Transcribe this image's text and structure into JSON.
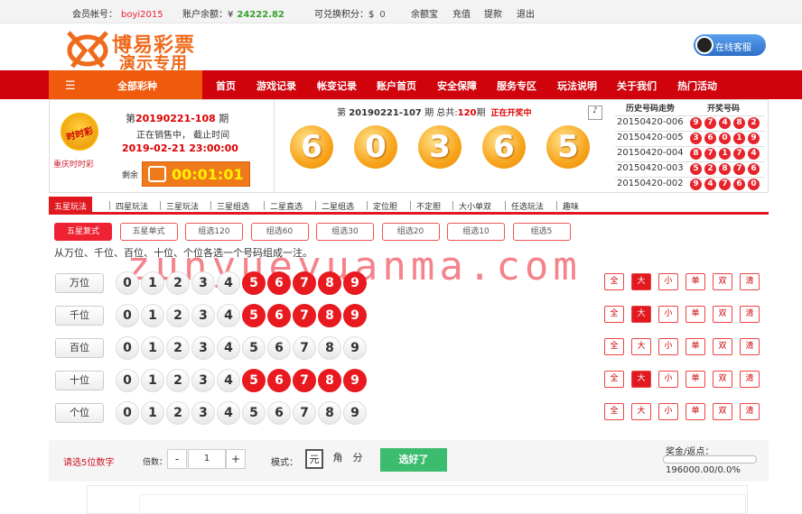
{
  "topbar": {
    "member_label": "会员帐号：",
    "member_value": "boyi2015",
    "balance_label": "账户余额：",
    "currency": "¥",
    "balance_value": "24222.82",
    "points_label": "可兑换积分：",
    "points_currency": "$",
    "points_value": "0",
    "links": [
      "余额宝",
      "充值",
      "提款",
      "退出"
    ]
  },
  "logo": {
    "line1": "博易彩票",
    "line2": "演示专用",
    "brand_color": "#ef6a1b"
  },
  "service_label": "在线客服",
  "nav": {
    "all_label": "全部彩种",
    "items": [
      "首页",
      "游戏记录",
      "帐变记录",
      "账户首页",
      "安全保障",
      "服务专区",
      "玩法说明",
      "关于我们",
      "热门活动"
    ],
    "bg_color": "#d0020b",
    "accent_color": "#ef5a0c"
  },
  "lottery": {
    "logo_text": "时时彩",
    "name": "重庆时时彩",
    "issue_prefix": "第",
    "issue": "20190221-108",
    "issue_suffix": "期",
    "status": "正在销售中，  截止时间",
    "deadline": "2019-02-21 23:00:00",
    "remaining_label": "剩余",
    "countdown": "00:01:01"
  },
  "draw": {
    "prefix": "第",
    "issue": "20190221-107",
    "mid": "期 总共:",
    "total": "120",
    "suffix": "期",
    "live": "正在开奖中",
    "numbers": [
      "6",
      "0",
      "3",
      "6",
      "5"
    ]
  },
  "history": {
    "header_trend": "历史号码走势",
    "header_numbers": "开奖号码",
    "rows": [
      {
        "issue": "20150420-006",
        "nums": [
          "9",
          "7",
          "4",
          "8",
          "2"
        ]
      },
      {
        "issue": "20150420-005",
        "nums": [
          "3",
          "6",
          "0",
          "1",
          "9"
        ]
      },
      {
        "issue": "20150420-004",
        "nums": [
          "8",
          "7",
          "1",
          "7",
          "4"
        ]
      },
      {
        "issue": "20150420-003",
        "nums": [
          "5",
          "2",
          "8",
          "7",
          "6"
        ]
      },
      {
        "issue": "20150420-002",
        "nums": [
          "9",
          "4",
          "7",
          "6",
          "0"
        ]
      }
    ]
  },
  "play_tabs": [
    "五星玩法",
    "四星玩法",
    "三星玩法",
    "三星组选",
    "二星直选",
    "二星组选",
    "定位胆",
    "不定胆",
    "大小单双",
    "任选玩法",
    "趣味"
  ],
  "sub_tabs": [
    "五星复式",
    "五星单式",
    "组选120",
    "组选60",
    "组选30",
    "组选20",
    "组选10",
    "组选5"
  ],
  "description": "从万位、千位、百位、十位、个位各选一个号码组成一注。",
  "watermark": "zunyueyuanma.com",
  "digits": [
    "0",
    "1",
    "2",
    "3",
    "4",
    "5",
    "6",
    "7",
    "8",
    "9"
  ],
  "positions": [
    {
      "label": "万位",
      "selected": [
        5,
        6,
        7,
        8,
        9
      ],
      "quick_selected": "大"
    },
    {
      "label": "千位",
      "selected": [
        5,
        6,
        7,
        8,
        9
      ],
      "quick_selected": "大"
    },
    {
      "label": "百位",
      "selected": [],
      "quick_selected": ""
    },
    {
      "label": "十位",
      "selected": [
        5,
        6,
        7,
        8,
        9
      ],
      "quick_selected": "大"
    },
    {
      "label": "个位",
      "selected": [],
      "quick_selected": ""
    }
  ],
  "quick_buttons": [
    "全",
    "大",
    "小",
    "单",
    "双",
    "清"
  ],
  "bottom": {
    "hint": "请选5位数字",
    "multiplier_label": "倍数：",
    "minus": "-",
    "multiplier_value": "1",
    "plus": "+",
    "mode_label": "模式：",
    "modes": [
      "元",
      "角",
      "分"
    ],
    "mode_selected": "元",
    "confirm": "选好了",
    "prize_label": "奖金/返点：",
    "prize_value": "196000.00/0.0%",
    "rebate_fraction": 0.0
  }
}
